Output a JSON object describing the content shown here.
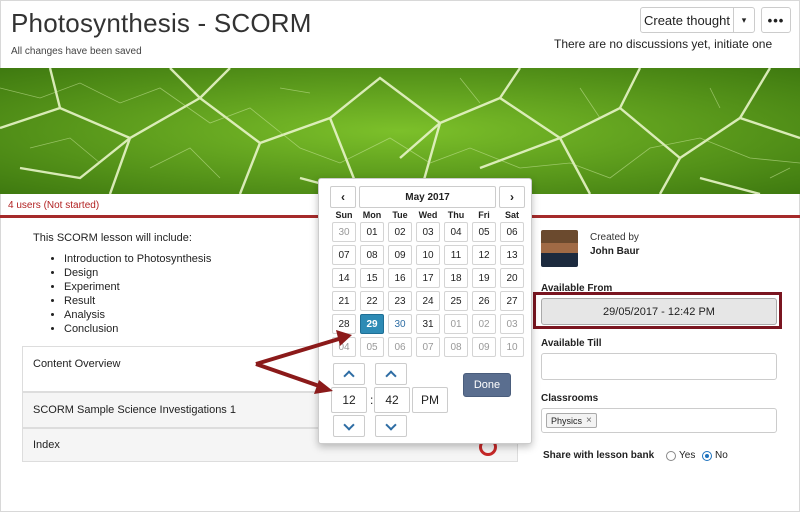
{
  "header": {
    "title": "Photosynthesis - SCORM",
    "saved_status": "All changes have been saved",
    "create_thought_label": "Create thought",
    "more_label": "•••",
    "caret": "▾",
    "discussions_text": "There are no discussions yet, initiate one"
  },
  "status": {
    "users_text": "4 users (Not started)"
  },
  "lesson": {
    "intro": "This SCORM lesson will include:",
    "topics": [
      "Introduction to Photosynthesis",
      "Design",
      "Experiment",
      "Result",
      "Analysis",
      "Conclusion"
    ],
    "panels": [
      "Content Overview",
      "SCORM Sample Science Investigations 1",
      "Index"
    ]
  },
  "sidebar": {
    "created_by_label": "Created by",
    "creator_name": "John Baur",
    "available_from_label": "Available From",
    "available_from_value": "29/05/2017 - 12:42 PM",
    "available_till_label": "Available Till",
    "available_till_value": "",
    "classrooms_label": "Classrooms",
    "classroom_tag": "Physics",
    "classroom_tag_remove": "×",
    "share_label": "Share with lesson bank",
    "share_yes": "Yes",
    "share_no": "No",
    "share_selected": "No"
  },
  "datepicker": {
    "prev": "‹",
    "next": "›",
    "month_label": "May 2017",
    "weekdays": [
      "Sun",
      "Mon",
      "Tue",
      "Wed",
      "Thu",
      "Fri",
      "Sat"
    ],
    "weeks": [
      [
        "30",
        "01",
        "02",
        "03",
        "04",
        "05",
        "06"
      ],
      [
        "07",
        "08",
        "09",
        "10",
        "11",
        "12",
        "13"
      ],
      [
        "14",
        "15",
        "16",
        "17",
        "18",
        "19",
        "20"
      ],
      [
        "21",
        "22",
        "23",
        "24",
        "25",
        "26",
        "27"
      ],
      [
        "28",
        "29",
        "30",
        "31",
        "01",
        "02",
        "03"
      ],
      [
        "04",
        "05",
        "06",
        "07",
        "08",
        "09",
        "10"
      ]
    ],
    "selected_day": "29",
    "hour": "12",
    "minute": "42",
    "colon": ":",
    "period": "PM",
    "done_label": "Done"
  },
  "colors": {
    "accent_red": "#a52a2a",
    "selected_blue": "#2e8bb5",
    "done_button": "#5a6e8f",
    "highlight_border": "#7a1520"
  },
  "icons": {
    "prev": "chevron-left-icon",
    "next": "chevron-right-icon",
    "spin_up": "chevron-up-icon",
    "spin_down": "chevron-down-icon",
    "caret": "caret-down-icon",
    "more": "ellipsis-icon"
  }
}
